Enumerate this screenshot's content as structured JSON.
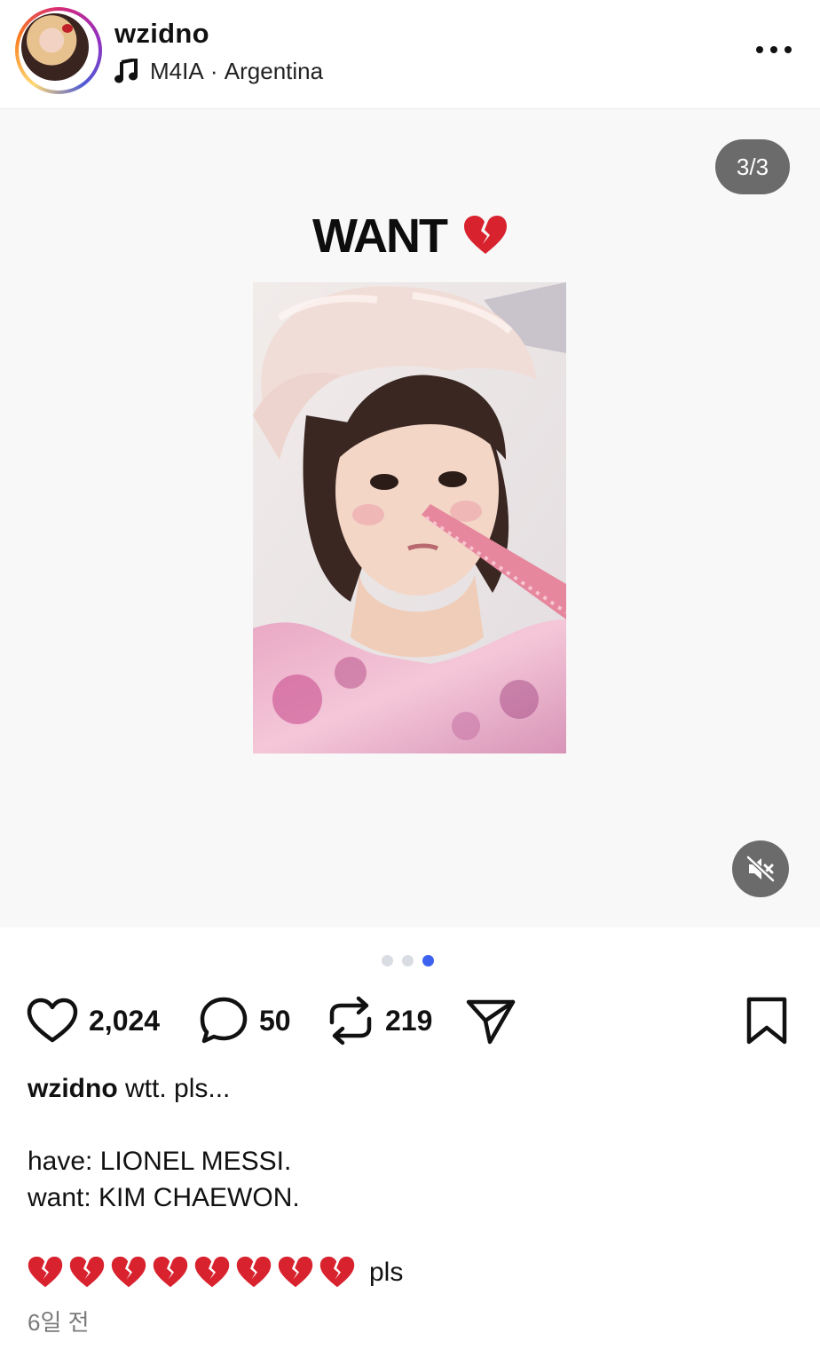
{
  "header": {
    "username": "wzidno",
    "music_label": "M4IA",
    "separator": " · ",
    "location": "Argentina"
  },
  "media": {
    "counter": "3/3",
    "overlay_title": "WANT",
    "overlay_emoji": "💔",
    "slide_count": 3,
    "active_slide": 3
  },
  "actions": {
    "likes": "2,024",
    "comments": "50",
    "reposts": "219"
  },
  "caption": {
    "username": "wzidno",
    "first_line": "wtt. pls...",
    "have_line": "have: LIONEL MESSI.",
    "want_line": "want: KIM CHAEWON.",
    "heart_count": 8,
    "end_text": "pls"
  },
  "timestamp": "6일 전",
  "colors": {
    "accent": "#3d62f0",
    "heart_emoji": "#d8232f",
    "overlay_button": "#6b6b6b"
  }
}
